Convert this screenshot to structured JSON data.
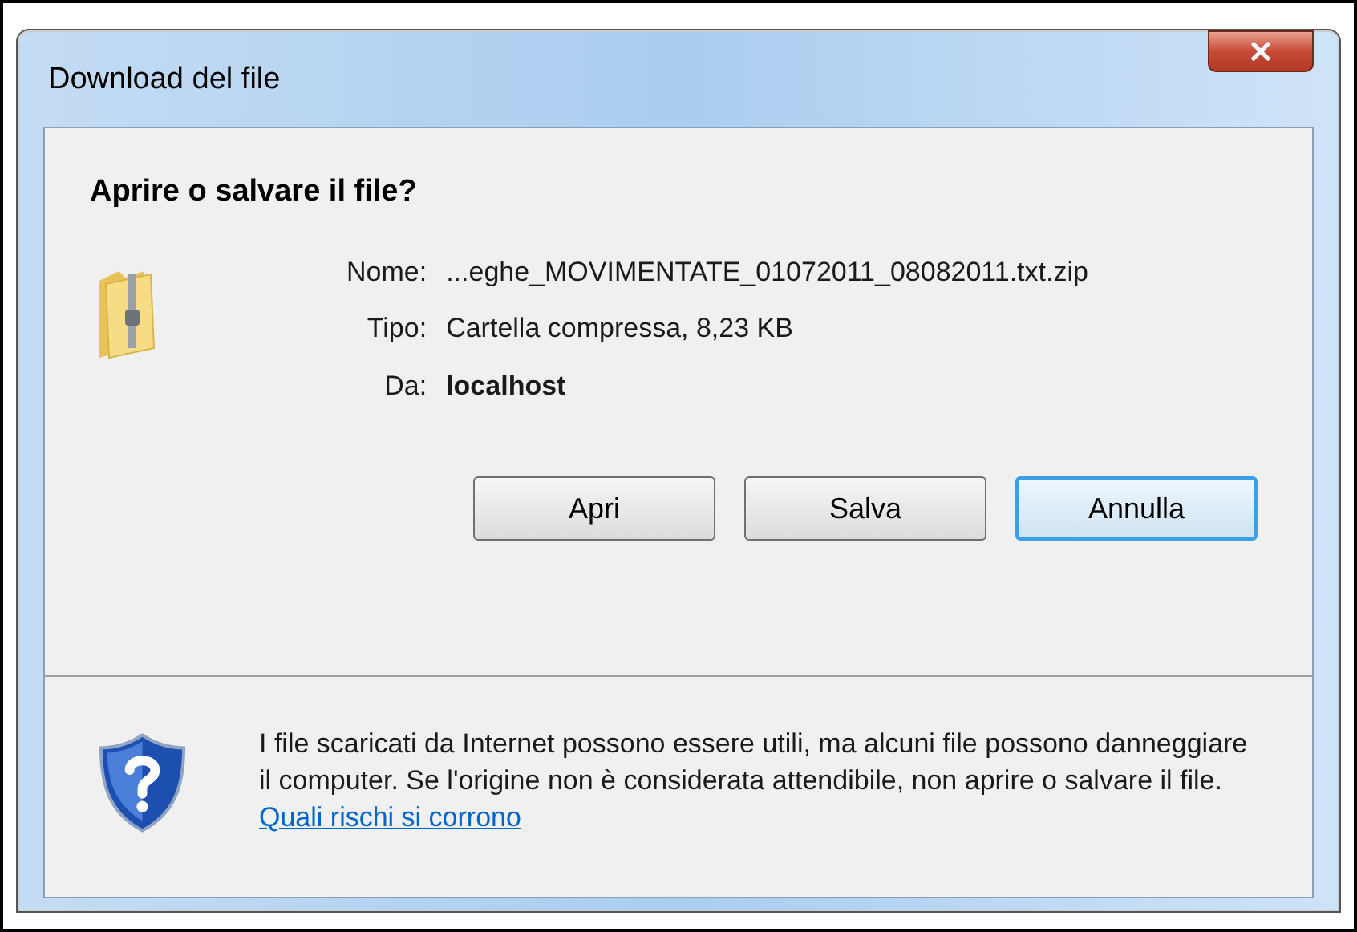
{
  "window": {
    "title": "Download del file"
  },
  "heading": "Aprire o salvare il file?",
  "fields": [
    {
      "label": "Nome:",
      "value": "...eghe_MOVIMENTATE_01072011_08082011.txt.zip",
      "bold": false
    },
    {
      "label": "Tipo:",
      "value": "Cartella compressa, 8,23 KB",
      "bold": false
    },
    {
      "label": "Da:",
      "value": "localhost",
      "bold": true
    }
  ],
  "buttons": [
    {
      "label": "Apri",
      "focused": false
    },
    {
      "label": "Salva",
      "focused": false
    },
    {
      "label": "Annulla",
      "focused": true
    }
  ],
  "warning": {
    "text": "I file scaricati da Internet possono essere utili, ma alcuni file possono danneggiare il computer. Se l'origine non è considerata attendibile, non aprire o salvare il file.",
    "link": "Quali rischi si corrono"
  }
}
